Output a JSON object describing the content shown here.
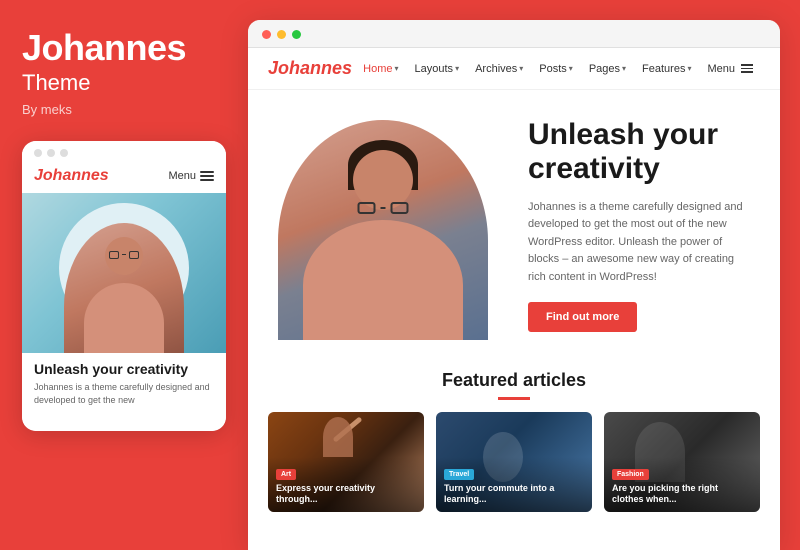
{
  "left": {
    "title": "Johannes",
    "subtitle": "Theme",
    "by": "By meks",
    "mobile": {
      "logo": "Johannes",
      "menu_label": "Menu",
      "hero_title": "Unleash your creativity",
      "hero_text": "Johannes is a theme carefully designed and developed to get the new"
    }
  },
  "right": {
    "browser_dots": [
      "red",
      "yellow",
      "green"
    ],
    "nav": {
      "logo": "Johannes",
      "links": [
        {
          "label": "Home",
          "active": true,
          "has_chevron": true
        },
        {
          "label": "Layouts",
          "active": false,
          "has_chevron": true
        },
        {
          "label": "Archives",
          "active": false,
          "has_chevron": true
        },
        {
          "label": "Posts",
          "active": false,
          "has_chevron": true
        },
        {
          "label": "Pages",
          "active": false,
          "has_chevron": true
        },
        {
          "label": "Features",
          "active": false,
          "has_chevron": true
        },
        {
          "label": "Menu",
          "active": false,
          "has_chevron": false,
          "has_menu_icon": true
        }
      ]
    },
    "hero": {
      "title": "Unleash your creativity",
      "description": "Johannes is a theme carefully designed and developed to get the most out of the new WordPress editor. Unleash the power of blocks – an awesome new way of creating rich content in WordPress!",
      "button_label": "Find out more"
    },
    "featured": {
      "title": "Featured articles",
      "cards": [
        {
          "badge": "Art",
          "badge_type": "art",
          "title": "Express your creativity through..."
        },
        {
          "badge": "Travel",
          "badge_type": "travel",
          "title": "Turn your commute into a learning..."
        },
        {
          "badge": "Fashion",
          "badge_type": "fashion",
          "title": "Are you picking the right clothes when..."
        }
      ]
    }
  }
}
